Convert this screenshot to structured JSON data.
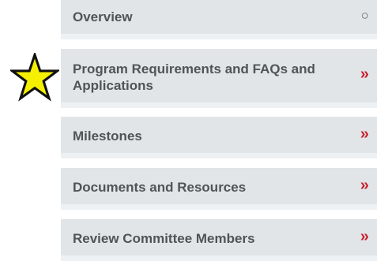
{
  "annotation": {
    "icon": "star-icon",
    "color": "#f5f000"
  },
  "colors": {
    "item_background": "#e1e5e8",
    "item_text": "#4f5458",
    "accent": "#c8202f"
  },
  "menu": {
    "items": [
      {
        "label": "Overview",
        "icon": "circle-icon",
        "icon_glyph": "○"
      },
      {
        "label": "Program Requirements and FAQs and Applications",
        "icon": "double-chevron-right-icon",
        "icon_glyph": "»"
      },
      {
        "label": "Milestones",
        "icon": "double-chevron-right-icon",
        "icon_glyph": "»"
      },
      {
        "label": "Documents and Resources",
        "icon": "double-chevron-right-icon",
        "icon_glyph": "»"
      },
      {
        "label": "Review Committee Members",
        "icon": "double-chevron-right-icon",
        "icon_glyph": "»"
      }
    ]
  }
}
